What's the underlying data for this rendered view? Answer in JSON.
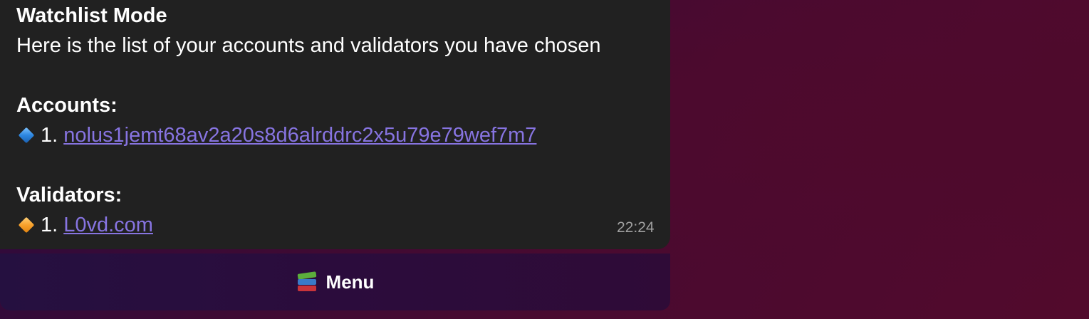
{
  "message": {
    "title": "Watchlist Mode",
    "intro": "Here is the list of your accounts and validators you have chosen",
    "accounts_heading": "Accounts:",
    "accounts": [
      {
        "icon": "blue-diamond-icon",
        "number": "1.",
        "address": "nolus1jemt68av2a20s8d6alrddrc2x5u79e79wef7m7"
      }
    ],
    "validators_heading": "Validators:",
    "validators": [
      {
        "icon": "orange-diamond-icon",
        "number": "1.",
        "name": "L0vd.com"
      }
    ],
    "time": "22:24"
  },
  "keyboard": {
    "menu_icon": "books-icon",
    "menu_label": "Menu"
  },
  "colors": {
    "bubble_bg": "#212121",
    "link": "#8774e1",
    "time": "#a0a0a0"
  }
}
